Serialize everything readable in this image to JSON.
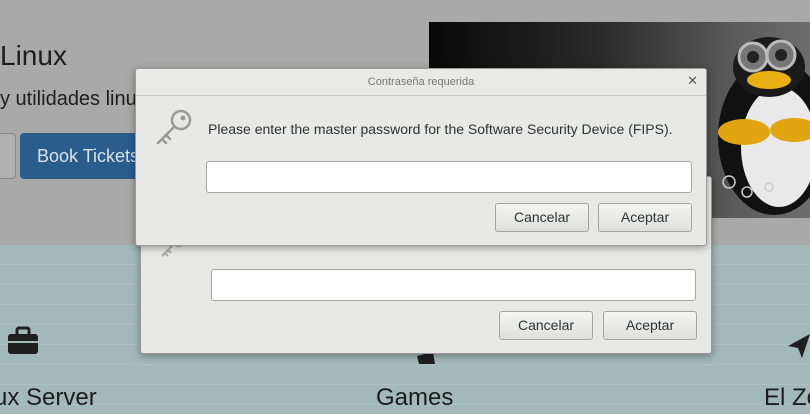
{
  "page": {
    "hero_title": "Linux",
    "hero_subtitle": "y utilidades linu",
    "book_button": "Book Tickets",
    "features": [
      {
        "label": "ux Server",
        "icon": "briefcase-icon"
      },
      {
        "label": "Games",
        "icon": "gamepad-icon"
      },
      {
        "label": "El Zo",
        "icon": "paper-plane-icon"
      }
    ]
  },
  "dialog_front": {
    "title": "Contraseña requerida",
    "message": "Please enter the master password for the Software Security Device (FIPS).",
    "password_value": "",
    "cancel_label": "Cancelar",
    "accept_label": "Aceptar",
    "icon": "key-icon"
  },
  "dialog_back": {
    "password_value": "",
    "cancel_label": "Cancelar",
    "accept_label": "Aceptar"
  },
  "colors": {
    "dialog_bg": "#e8e8e7",
    "book_button_bg": "#2b5d8c",
    "page_top_bg": "#a9a9a9",
    "page_bottom_bg": "#a3b8b9"
  }
}
